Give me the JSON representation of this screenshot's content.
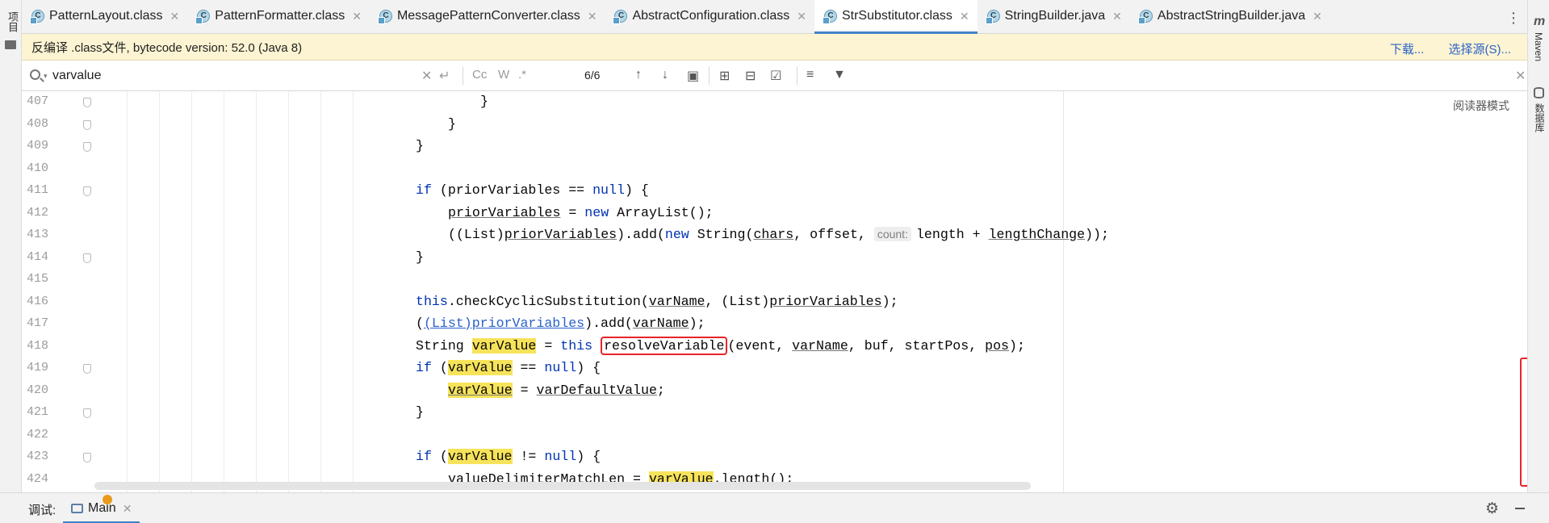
{
  "left_panel": {
    "project_label": "项目"
  },
  "right_panel": {
    "maven_label": "Maven",
    "database_label": "数据库",
    "maven_icon": "m-icon",
    "database_icon": "database-icon"
  },
  "tabs": [
    {
      "label": "PatternLayout.class",
      "icon": "class-icon",
      "active": false
    },
    {
      "label": "PatternFormatter.class",
      "icon": "class-icon",
      "active": false
    },
    {
      "label": "MessagePatternConverter.class",
      "icon": "class-icon",
      "active": false
    },
    {
      "label": "AbstractConfiguration.class",
      "icon": "class-icon",
      "active": false
    },
    {
      "label": "StrSubstitutor.class",
      "icon": "class-icon",
      "active": true
    },
    {
      "label": "StringBuilder.java",
      "icon": "class-icon",
      "active": false
    },
    {
      "label": "AbstractStringBuilder.java",
      "icon": "class-icon",
      "active": false
    }
  ],
  "notice": {
    "text": "反编译 .class文件, bytecode version: 52.0 (Java 8)",
    "download_link": "下载...",
    "choose_source_link": "选择源(S)..."
  },
  "search": {
    "value": "varvalue",
    "match_count": "6/6",
    "case_label": "Cc",
    "word_label": "W",
    "regex_label": ".*"
  },
  "editor": {
    "reader_mode": "阅读器模式",
    "line_numbers": [
      "407",
      "408",
      "409",
      "410",
      "411",
      "412",
      "413",
      "414",
      "415",
      "416",
      "417",
      "418",
      "419",
      "420",
      "421",
      "422",
      "423",
      "424"
    ],
    "code": {
      "l407": "}",
      "l408": "}",
      "l409": "}",
      "l411_a": "if",
      "l411_b": " (priorVariables == ",
      "l411_c": "null",
      "l411_d": ") {",
      "l412_a": "priorVariables",
      "l412_b": " = ",
      "l412_c": "new",
      "l412_d": " ArrayList();",
      "l413_a": "((List)",
      "l413_b": "priorVariables",
      "l413_c": ").add(",
      "l413_d": "new",
      "l413_e": " String(",
      "l413_f": "chars",
      "l413_g": ", offset, ",
      "l413_hint": "count:",
      "l413_h": "length + ",
      "l413_i": "lengthChange",
      "l413_j": "));",
      "l414": "}",
      "l416_a": "this",
      "l416_b": ".checkCyclicSubstitution(",
      "l416_c": "varName",
      "l416_d": ", (List)",
      "l416_e": "priorVariables",
      "l416_f": ");",
      "l417_a": "(",
      "l417_b": "(List)priorVariables",
      "l417_c": ").add(",
      "l417_d": "varName",
      "l417_e": ");",
      "l418_a": "String ",
      "l418_b": "varValue",
      "l418_c": " = ",
      "l418_d": "this",
      "l418_e": "resolveVariable",
      "l418_f": "(event, ",
      "l418_g": "varName",
      "l418_h": ", buf, startPos, ",
      "l418_i": "pos",
      "l418_j": ");",
      "l419_a": "if",
      "l419_b": " (",
      "l419_c": "varValue",
      "l419_d": " == ",
      "l419_e": "null",
      "l419_f": ") {",
      "l420_a": "varValue",
      "l420_b": " = ",
      "l420_c": "varDefaultValue",
      "l420_d": ";",
      "l421": "}",
      "l423_a": "if",
      "l423_b": " (",
      "l423_c": "varValue",
      "l423_d": " != ",
      "l423_e": "null",
      "l423_f": ") {",
      "l424_a": "valueDelimiterMatchLen = ",
      "l424_b": "varValue",
      "l424_c": ".length();"
    }
  },
  "bottom": {
    "debug_label": "调试:",
    "run_tab_label": "Main"
  }
}
